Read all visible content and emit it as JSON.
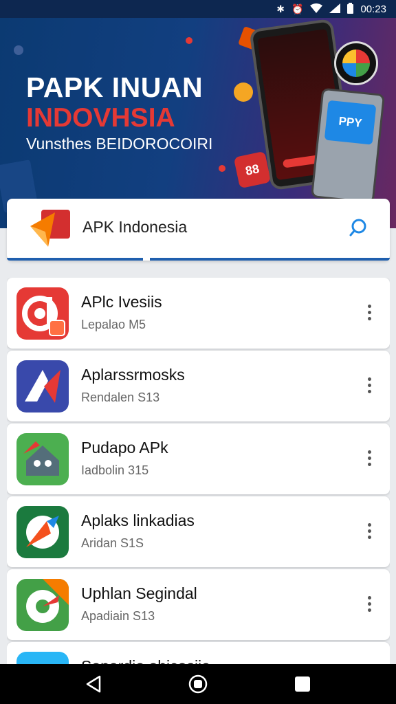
{
  "status_bar": {
    "time": "00:23",
    "icons": [
      "bluetooth-icon",
      "alarm-icon",
      "wifi-icon",
      "signal-icon",
      "battery-icon"
    ]
  },
  "banner": {
    "title_line1": "PAPK INUAN",
    "title_line2": "INDOVHSIA",
    "subtitle": "Vunsthes BEIDOROCOIRI",
    "badge_text": "88",
    "device_label": "PPY"
  },
  "search": {
    "text": "APK Indonesia",
    "icon": "search-icon"
  },
  "apps": [
    {
      "name": "APlc Ivesiis",
      "subtitle": "Lepalao M5",
      "icon": "app-icon-red"
    },
    {
      "name": "Aplarssrmosks",
      "subtitle": "Rendalen S13",
      "icon": "app-icon-blue"
    },
    {
      "name": "Pudapo APk",
      "subtitle": "Iadbolin 315",
      "icon": "app-icon-green"
    },
    {
      "name": "Aplaks linkadias",
      "subtitle": "Aridan S1S",
      "icon": "app-icon-darkgreen"
    },
    {
      "name": "Uphlan Segindal",
      "subtitle": "Apadiain S13",
      "icon": "app-icon-greenorange"
    },
    {
      "name": "Sopardio ohicosiie",
      "subtitle": "",
      "icon": "app-icon-lightblue"
    }
  ],
  "nav": {
    "icons": [
      "back-icon",
      "home-icon",
      "recents-icon"
    ]
  },
  "colors": {
    "status_bar_bg": "#0d2750",
    "banner_bg": "#123f80",
    "accent_red": "#e53935",
    "accent_blue": "#1f5fae"
  }
}
